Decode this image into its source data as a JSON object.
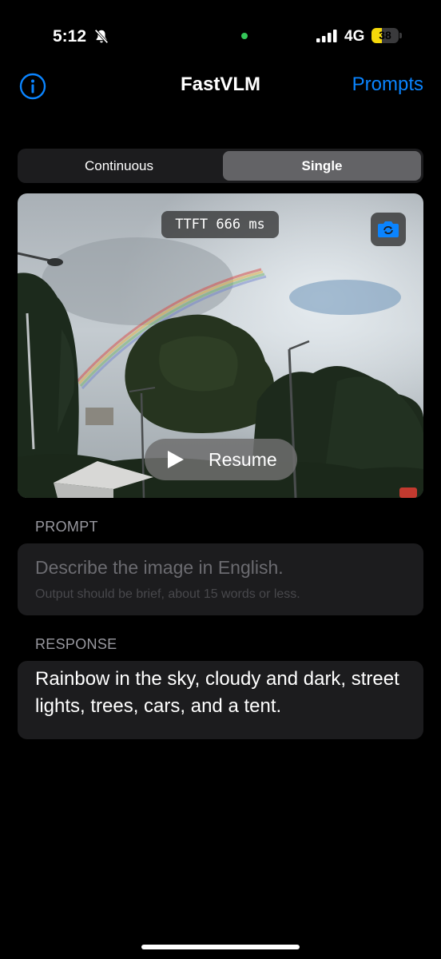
{
  "status_bar": {
    "time": "5:12",
    "network": "4G",
    "battery_percent": "38",
    "battery_level": 0.38,
    "icons": [
      "bell-slash-icon",
      "cellular-signal-icon",
      "battery-icon"
    ],
    "indicator_color": "#34c759",
    "battery_color": "#f5d90a"
  },
  "nav": {
    "title": "FastVLM",
    "prompts_label": "Prompts",
    "info_icon": "info-circle-icon",
    "accent_color": "#0a84ff"
  },
  "mode_selector": {
    "options": [
      "Continuous",
      "Single"
    ],
    "selected": "Single"
  },
  "camera": {
    "ttft_label": "TTFT 666 ms",
    "switch_camera_icon": "camera-rotate-icon",
    "resume_label": "Resume",
    "resume_icon": "play-icon"
  },
  "prompt": {
    "header": "PROMPT",
    "text": "Describe the image in English.",
    "hint": "Output should be brief, about 15 words or less."
  },
  "response": {
    "header": "RESPONSE",
    "text": "Rainbow in the sky, cloudy and dark, street lights, trees, cars, and a tent."
  }
}
